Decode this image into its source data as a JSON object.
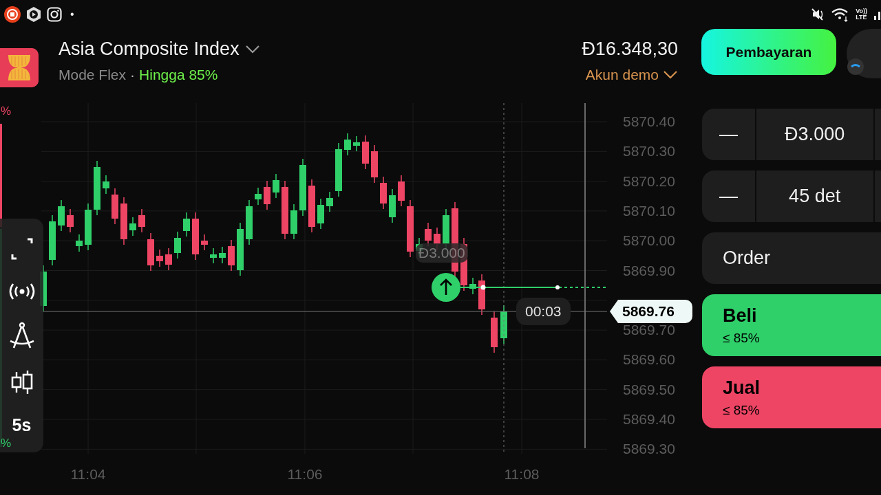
{
  "status_bar": {
    "dot": "•",
    "network": [
      "Vo))",
      "LTE"
    ]
  },
  "asset": {
    "name": "Asia Composite Index",
    "mode": "Mode Flex",
    "separator": "·",
    "payout": "Hingga 85%"
  },
  "account": {
    "balance": "Đ16.348,30",
    "type": "Akun demo"
  },
  "payment_button": "Pembayaran",
  "chart": {
    "edge_labels": [
      {
        "text": "%",
        "kind": "sell"
      },
      {
        "text": "%",
        "kind": "buy"
      }
    ],
    "price_ticks": [
      "5870.40",
      "5870.30",
      "5870.20",
      "5870.10",
      "5870.00",
      "5869.90",
      "5869.70",
      "5869.60",
      "5869.50",
      "5869.40",
      "5869.30"
    ],
    "time_ticks": [
      "11:04",
      "11:06",
      "11:08"
    ],
    "trade_amount": "Đ3.000",
    "timer": "00:03",
    "current_price": "5869.76",
    "timeframe": "5s"
  },
  "trade_panel": {
    "amount": {
      "minus": "—",
      "value": "Đ3.000"
    },
    "duration": {
      "minus": "—",
      "value": "45 det"
    },
    "order_label": "Order",
    "actions": [
      {
        "kind": "buy",
        "label": "Beli",
        "payout": "≤ 85%"
      },
      {
        "kind": "sell",
        "label": "Jual",
        "payout": "≤ 85%"
      }
    ]
  }
}
